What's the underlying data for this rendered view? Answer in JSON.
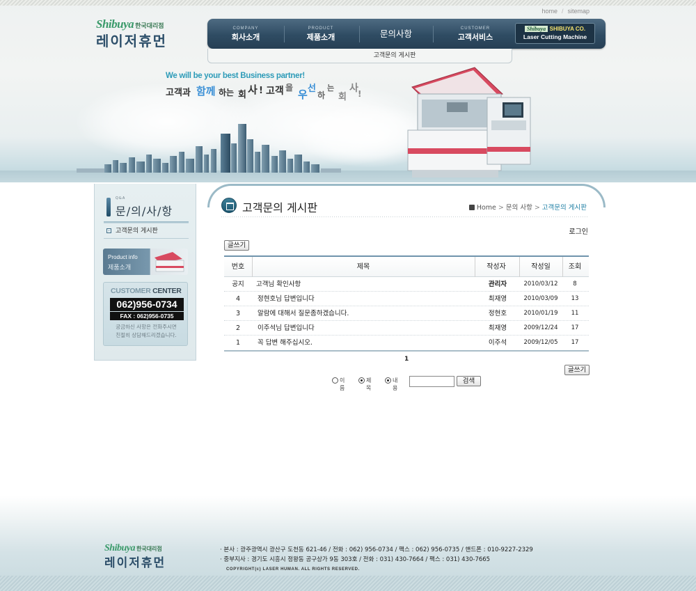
{
  "top_links": {
    "home": "home",
    "sep": "/",
    "sitemap": "sitemap"
  },
  "logo": {
    "brand": "Shibuya",
    "sub": "한국대리점",
    "name": "레이저휴먼"
  },
  "gnb": {
    "items": [
      {
        "en": "COMPANY",
        "ko": "회사소개"
      },
      {
        "en": "PRODUCT",
        "ko": "제품소개"
      },
      {
        "en": "",
        "ko": "문의사항"
      },
      {
        "en": "CUSTOMER",
        "ko": "고객서비스"
      }
    ],
    "brand_badge": {
      "logo": "Shibuya",
      "company": "SHIBUYA CO.",
      "tagline": "Laser Cutting Machine"
    }
  },
  "sub_gnb": {
    "item": "고객문의 게시판"
  },
  "slogan": {
    "en": "We will be your best Business partner!",
    "ko_parts": [
      "고객과",
      "함께",
      "하는",
      "회",
      "사",
      "!",
      "고객",
      "을",
      "우",
      "선",
      "하",
      "는",
      "회",
      "사",
      "!"
    ]
  },
  "sidebar": {
    "title_en": "Q&A",
    "title_ko": "문/의/사/항",
    "menu_item": "고객문의 게시판",
    "product_banner": {
      "en": "Product info",
      "ko": "제품소개"
    },
    "customer_center": {
      "title_a": "CUSTOMER",
      "title_b": "CENTER",
      "phone": "062)956-0734",
      "fax": "FAX : 062)956-0735",
      "note_line1": "궁금하신 사항은 전화주시면",
      "note_line2": "친절히 상담해드리겠습니다."
    }
  },
  "content": {
    "title": "고객문의 게시판",
    "breadcrumb": [
      "Home",
      "문의 사항",
      "고객문의 게시판"
    ],
    "breadcrumb_arrow": ">",
    "login": "로그인",
    "write_button": "글쓰기",
    "columns": [
      "번호",
      "제목",
      "작성자",
      "작성일",
      "조회"
    ],
    "rows": [
      {
        "no": "공지",
        "subject": "고객님 확인사항",
        "writer": "관리자",
        "date": "2010/03/12",
        "hits": "8"
      },
      {
        "no": "4",
        "subject": "정현호님 답변입니다",
        "writer": "최재영",
        "date": "2010/03/09",
        "hits": "13"
      },
      {
        "no": "3",
        "subject": "알람에 대해서 질문좀하겠습니다.",
        "writer": "정현호",
        "date": "2010/01/19",
        "hits": "11"
      },
      {
        "no": "2",
        "subject": "이주석님 답변입니다",
        "writer": "최재영",
        "date": "2009/12/24",
        "hits": "17"
      },
      {
        "no": "1",
        "subject": "꼭 답변 해주십시오.",
        "writer": "이주석",
        "date": "2009/12/05",
        "hits": "17"
      }
    ],
    "page": "1",
    "search": {
      "options": [
        {
          "label": "이름",
          "checked": false
        },
        {
          "label": "제목",
          "checked": true
        },
        {
          "label": "내용",
          "checked": true
        }
      ],
      "input_value": "",
      "button": "검색"
    }
  },
  "footer": {
    "line1": "· 본사 : 광주광역시 광산구 도천동 621-46  /  전화 : 062) 956-0734  /  팩스 : 062) 956-0735  /  핸드폰 : 010-9227-2329",
    "line2": "· 중부지사 : 경기도 시흥시 정왕동 공구상가 9동 303호  /  전화 : 031) 430-7664  /  팩스 : 031) 430-7665",
    "copyright": "COPYRIGHT(c) LASER HUMAN. ALL RIGHTS RESERVED."
  }
}
